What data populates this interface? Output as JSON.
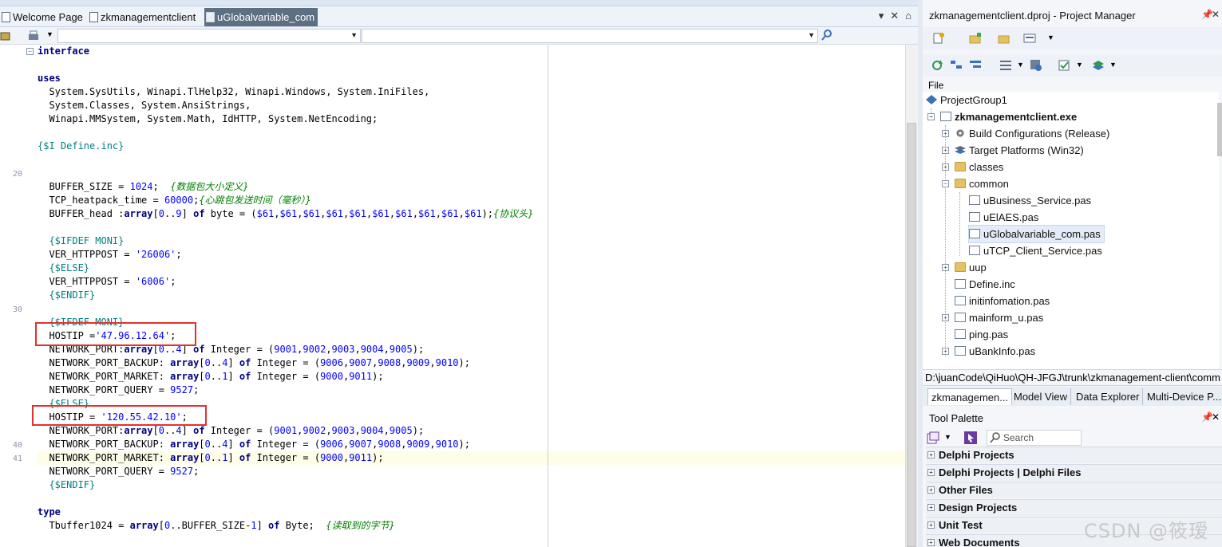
{
  "editor_tabs": [
    {
      "label": "Welcome Page"
    },
    {
      "label": "zkmanagementclient"
    },
    {
      "label": "uGlobalvariable_com"
    }
  ],
  "line_numbers": [
    "20",
    "30",
    "40",
    "41"
  ],
  "code_lines": [
    [
      {
        "t": "interface",
        "c": "kw"
      }
    ],
    [],
    [
      {
        "t": "uses",
        "c": "kw"
      }
    ],
    [
      {
        "t": "  System.SysUtils, Winapi.TlHelp32, Winapi.Windows, System.IniFiles,",
        "c": ""
      }
    ],
    [
      {
        "t": "  System.Classes, System.AnsiStrings,",
        "c": ""
      }
    ],
    [
      {
        "t": "  Winapi.MMSystem, System.Math, IdHTTP, System.NetEncoding;",
        "c": ""
      }
    ],
    [],
    [
      {
        "t": "{$I Define.inc}",
        "c": "dir"
      }
    ],
    [],
    [],
    [
      {
        "t": "  BUFFER_SIZE = ",
        "c": ""
      },
      {
        "t": "1024",
        "c": "num"
      },
      {
        "t": ";  ",
        "c": ""
      },
      {
        "t": "{数据包大小定义}",
        "c": "cmt"
      }
    ],
    [
      {
        "t": "  TCP_heatpack_time = ",
        "c": ""
      },
      {
        "t": "60000",
        "c": "num"
      },
      {
        "t": ";",
        "c": ""
      },
      {
        "t": "{心跳包发送时间（毫秒）}",
        "c": "cmt"
      }
    ],
    [
      {
        "t": "  BUFFER_head :",
        "c": ""
      },
      {
        "t": "array",
        "c": "kw"
      },
      {
        "t": "[",
        "c": ""
      },
      {
        "t": "0",
        "c": "num"
      },
      {
        "t": "..",
        "c": ""
      },
      {
        "t": "9",
        "c": "num"
      },
      {
        "t": "] ",
        "c": ""
      },
      {
        "t": "of",
        "c": "kw"
      },
      {
        "t": " byte = (",
        "c": ""
      },
      {
        "t": "$61",
        "c": "num"
      },
      {
        "t": ",",
        "c": ""
      },
      {
        "t": "$61",
        "c": "num"
      },
      {
        "t": ",",
        "c": ""
      },
      {
        "t": "$61",
        "c": "num"
      },
      {
        "t": ",",
        "c": ""
      },
      {
        "t": "$61",
        "c": "num"
      },
      {
        "t": ",",
        "c": ""
      },
      {
        "t": "$61",
        "c": "num"
      },
      {
        "t": ",",
        "c": ""
      },
      {
        "t": "$61",
        "c": "num"
      },
      {
        "t": ",",
        "c": ""
      },
      {
        "t": "$61",
        "c": "num"
      },
      {
        "t": ",",
        "c": ""
      },
      {
        "t": "$61",
        "c": "num"
      },
      {
        "t": ",",
        "c": ""
      },
      {
        "t": "$61",
        "c": "num"
      },
      {
        "t": ",",
        "c": ""
      },
      {
        "t": "$61",
        "c": "num"
      },
      {
        "t": ");",
        "c": ""
      },
      {
        "t": "{协议头}",
        "c": "cmt"
      }
    ],
    [],
    [
      {
        "t": "  {$IFDEF MONI}",
        "c": "dir"
      }
    ],
    [
      {
        "t": "  VER_HTTPPOST = ",
        "c": ""
      },
      {
        "t": "'26006'",
        "c": "str"
      },
      {
        "t": ";",
        "c": ""
      }
    ],
    [
      {
        "t": "  {$ELSE}",
        "c": "dir"
      }
    ],
    [
      {
        "t": "  VER_HTTPPOST = ",
        "c": ""
      },
      {
        "t": "'6006'",
        "c": "str"
      },
      {
        "t": ";",
        "c": ""
      }
    ],
    [
      {
        "t": "  {$ENDIF}",
        "c": "dir"
      }
    ],
    [],
    [
      {
        "t": "  {$IFDEF MONI}",
        "c": "dir"
      }
    ],
    [
      {
        "t": "  HOSTIP =",
        "c": ""
      },
      {
        "t": "'47.96.12.64'",
        "c": "str"
      },
      {
        "t": ";",
        "c": ""
      }
    ],
    [
      {
        "t": "  NETWORK_PORT:",
        "c": ""
      },
      {
        "t": "array",
        "c": "kw"
      },
      {
        "t": "[",
        "c": ""
      },
      {
        "t": "0",
        "c": "num"
      },
      {
        "t": "..",
        "c": ""
      },
      {
        "t": "4",
        "c": "num"
      },
      {
        "t": "] ",
        "c": ""
      },
      {
        "t": "of",
        "c": "kw"
      },
      {
        "t": " Integer = (",
        "c": ""
      },
      {
        "t": "9001",
        "c": "num"
      },
      {
        "t": ",",
        "c": ""
      },
      {
        "t": "9002",
        "c": "num"
      },
      {
        "t": ",",
        "c": ""
      },
      {
        "t": "9003",
        "c": "num"
      },
      {
        "t": ",",
        "c": ""
      },
      {
        "t": "9004",
        "c": "num"
      },
      {
        "t": ",",
        "c": ""
      },
      {
        "t": "9005",
        "c": "num"
      },
      {
        "t": ");",
        "c": ""
      }
    ],
    [
      {
        "t": "  NETWORK_PORT_BACKUP: ",
        "c": ""
      },
      {
        "t": "array",
        "c": "kw"
      },
      {
        "t": "[",
        "c": ""
      },
      {
        "t": "0",
        "c": "num"
      },
      {
        "t": "..",
        "c": ""
      },
      {
        "t": "4",
        "c": "num"
      },
      {
        "t": "] ",
        "c": ""
      },
      {
        "t": "of",
        "c": "kw"
      },
      {
        "t": " Integer = (",
        "c": ""
      },
      {
        "t": "9006",
        "c": "num"
      },
      {
        "t": ",",
        "c": ""
      },
      {
        "t": "9007",
        "c": "num"
      },
      {
        "t": ",",
        "c": ""
      },
      {
        "t": "9008",
        "c": "num"
      },
      {
        "t": ",",
        "c": ""
      },
      {
        "t": "9009",
        "c": "num"
      },
      {
        "t": ",",
        "c": ""
      },
      {
        "t": "9010",
        "c": "num"
      },
      {
        "t": ");",
        "c": ""
      }
    ],
    [
      {
        "t": "  NETWORK_PORT_MARKET: ",
        "c": ""
      },
      {
        "t": "array",
        "c": "kw"
      },
      {
        "t": "[",
        "c": ""
      },
      {
        "t": "0",
        "c": "num"
      },
      {
        "t": "..",
        "c": ""
      },
      {
        "t": "1",
        "c": "num"
      },
      {
        "t": "] ",
        "c": ""
      },
      {
        "t": "of",
        "c": "kw"
      },
      {
        "t": " Integer = (",
        "c": ""
      },
      {
        "t": "9000",
        "c": "num"
      },
      {
        "t": ",",
        "c": ""
      },
      {
        "t": "9011",
        "c": "num"
      },
      {
        "t": ");",
        "c": ""
      }
    ],
    [
      {
        "t": "  NETWORK_PORT_QUERY = ",
        "c": ""
      },
      {
        "t": "9527",
        "c": "num"
      },
      {
        "t": ";",
        "c": ""
      }
    ],
    [
      {
        "t": "  {$ELSE}",
        "c": "dir"
      }
    ],
    [
      {
        "t": "  HOSTIP = ",
        "c": ""
      },
      {
        "t": "'120.55.42.10'",
        "c": "str"
      },
      {
        "t": ";",
        "c": ""
      }
    ],
    [
      {
        "t": "  NETWORK_PORT:",
        "c": ""
      },
      {
        "t": "array",
        "c": "kw"
      },
      {
        "t": "[",
        "c": ""
      },
      {
        "t": "0",
        "c": "num"
      },
      {
        "t": "..",
        "c": ""
      },
      {
        "t": "4",
        "c": "num"
      },
      {
        "t": "] ",
        "c": ""
      },
      {
        "t": "of",
        "c": "kw"
      },
      {
        "t": " Integer = (",
        "c": ""
      },
      {
        "t": "9001",
        "c": "num"
      },
      {
        "t": ",",
        "c": ""
      },
      {
        "t": "9002",
        "c": "num"
      },
      {
        "t": ",",
        "c": ""
      },
      {
        "t": "9003",
        "c": "num"
      },
      {
        "t": ",",
        "c": ""
      },
      {
        "t": "9004",
        "c": "num"
      },
      {
        "t": ",",
        "c": ""
      },
      {
        "t": "9005",
        "c": "num"
      },
      {
        "t": ");",
        "c": ""
      }
    ],
    [
      {
        "t": "  NETWORK_PORT_BACKUP: ",
        "c": ""
      },
      {
        "t": "array",
        "c": "kw"
      },
      {
        "t": "[",
        "c": ""
      },
      {
        "t": "0",
        "c": "num"
      },
      {
        "t": "..",
        "c": ""
      },
      {
        "t": "4",
        "c": "num"
      },
      {
        "t": "] ",
        "c": ""
      },
      {
        "t": "of",
        "c": "kw"
      },
      {
        "t": " Integer = (",
        "c": ""
      },
      {
        "t": "9006",
        "c": "num"
      },
      {
        "t": ",",
        "c": ""
      },
      {
        "t": "9007",
        "c": "num"
      },
      {
        "t": ",",
        "c": ""
      },
      {
        "t": "9008",
        "c": "num"
      },
      {
        "t": ",",
        "c": ""
      },
      {
        "t": "9009",
        "c": "num"
      },
      {
        "t": ",",
        "c": ""
      },
      {
        "t": "9010",
        "c": "num"
      },
      {
        "t": ");",
        "c": ""
      }
    ],
    [
      {
        "t": "  NETWORK_PORT_MARKET: ",
        "c": ""
      },
      {
        "t": "array",
        "c": "kw"
      },
      {
        "t": "[",
        "c": ""
      },
      {
        "t": "0",
        "c": "num"
      },
      {
        "t": "..",
        "c": ""
      },
      {
        "t": "1",
        "c": "num"
      },
      {
        "t": "] ",
        "c": ""
      },
      {
        "t": "of",
        "c": "kw"
      },
      {
        "t": " Integer = (",
        "c": ""
      },
      {
        "t": "9000",
        "c": "num"
      },
      {
        "t": ",",
        "c": ""
      },
      {
        "t": "9011",
        "c": "num"
      },
      {
        "t": ");",
        "c": ""
      }
    ],
    [
      {
        "t": "  NETWORK_PORT_QUERY = ",
        "c": ""
      },
      {
        "t": "9527",
        "c": "num"
      },
      {
        "t": ";",
        "c": ""
      }
    ],
    [
      {
        "t": "  {$ENDIF}",
        "c": "dir"
      }
    ],
    [],
    [
      {
        "t": "type",
        "c": "kw"
      }
    ],
    [
      {
        "t": "  Tbuffer1024 = ",
        "c": ""
      },
      {
        "t": "array",
        "c": "kw"
      },
      {
        "t": "[",
        "c": ""
      },
      {
        "t": "0",
        "c": "num"
      },
      {
        "t": "..BUFFER_SIZE-",
        "c": ""
      },
      {
        "t": "1",
        "c": "num"
      },
      {
        "t": "] ",
        "c": ""
      },
      {
        "t": "of",
        "c": "kw"
      },
      {
        "t": " Byte;  ",
        "c": ""
      },
      {
        "t": "{读取到的字节}",
        "c": "cmt"
      }
    ]
  ],
  "project_manager": {
    "title": "zkmanagementclient.dproj - Project Manager",
    "column_header": "File",
    "tree": [
      {
        "label": "ProjectGroup1"
      },
      {
        "label": "zkmanagementclient.exe"
      },
      {
        "label": "Build Configurations (Release)"
      },
      {
        "label": "Target Platforms (Win32)"
      },
      {
        "label": "classes"
      },
      {
        "label": "common"
      },
      {
        "label": "uBusiness_Service.pas"
      },
      {
        "label": "uElAES.pas"
      },
      {
        "label": "uGlobalvariable_com.pas"
      },
      {
        "label": "uTCP_Client_Service.pas"
      },
      {
        "label": "uup"
      },
      {
        "label": "Define.inc"
      },
      {
        "label": "initinfomation.pas"
      },
      {
        "label": "mainform_u.pas"
      },
      {
        "label": "ping.pas"
      },
      {
        "label": "uBankInfo.pas"
      }
    ],
    "path": "D:\\juanCode\\QiHuo\\QH-JFGJ\\trunk\\zkmanagement-client\\comm",
    "tabs": [
      {
        "label": "zkmanagemen..."
      },
      {
        "label": "Model View"
      },
      {
        "label": "Data Explorer"
      },
      {
        "label": "Multi-Device P..."
      }
    ]
  },
  "tool_palette": {
    "title": "Tool Palette",
    "search_label": "Search",
    "categories": [
      {
        "label": "Delphi Projects"
      },
      {
        "label": "Delphi Projects | Delphi Files"
      },
      {
        "label": "Other Files"
      },
      {
        "label": "Design Projects"
      },
      {
        "label": "Unit Test"
      },
      {
        "label": "Web Documents"
      }
    ]
  },
  "watermark": "CSDN @筱瑷",
  "colors": {
    "active_tab": "#5d6f82",
    "highlight_box": "#e3302f",
    "keyword": "#000080",
    "number": "#0000ff",
    "directive": "#008080",
    "comment": "#008000"
  }
}
